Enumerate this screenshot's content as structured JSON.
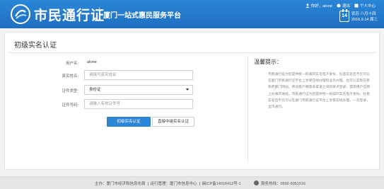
{
  "header": {
    "logo_text": "市民通行证",
    "slogan": "厦门一站式惠民服务平台",
    "greeting": "你好，atone",
    "logout": "退出",
    "personal_center": "个人中心",
    "lunar_date": "农历 八月十四",
    "solar_date": "2016.9.14 周三",
    "calendar_day": "14"
  },
  "page": {
    "title": "初级实名认证"
  },
  "form": {
    "username_label": "用户名:",
    "username_value": "atone",
    "realname_label": "真实姓名:",
    "realname_placeholder": "请填写真实姓名",
    "idtype_label": "证件类型:",
    "idtype_value": "身份证",
    "idnumber_label": "证件号码:",
    "idnumber_placeholder": "请输入有效证件号",
    "primary_button": "初级实名认证",
    "secondary_button": "直接中级实名认证"
  },
  "tips": {
    "title": "温馨提示：",
    "text": "市民通行证为您提供统一权威的实名电子身份，任意实名后不仅可以在厦门市民通行证平台上享受在线办理和业务办理，也可以实现在各政府部门网站、移动客户端等多渠道之间的单点登录，提高用户在网上办事的体验。市民通行证为您提供统一权威的实名电子身份，任意实名后不仅可以在厦门市民通行证平台上享受在线办理，一次登录，全市通行。"
  },
  "footer": {
    "sponsor": "主办：厦门市经济和信息化局",
    "operator": "运行管理：厦门市信息中心",
    "icp": "闽ICP备14016412号-1",
    "hotline": "服务热线：0592-5051516"
  },
  "colors": {
    "header_blue": "#2a86d8",
    "primary_button": "#2d86d6"
  }
}
